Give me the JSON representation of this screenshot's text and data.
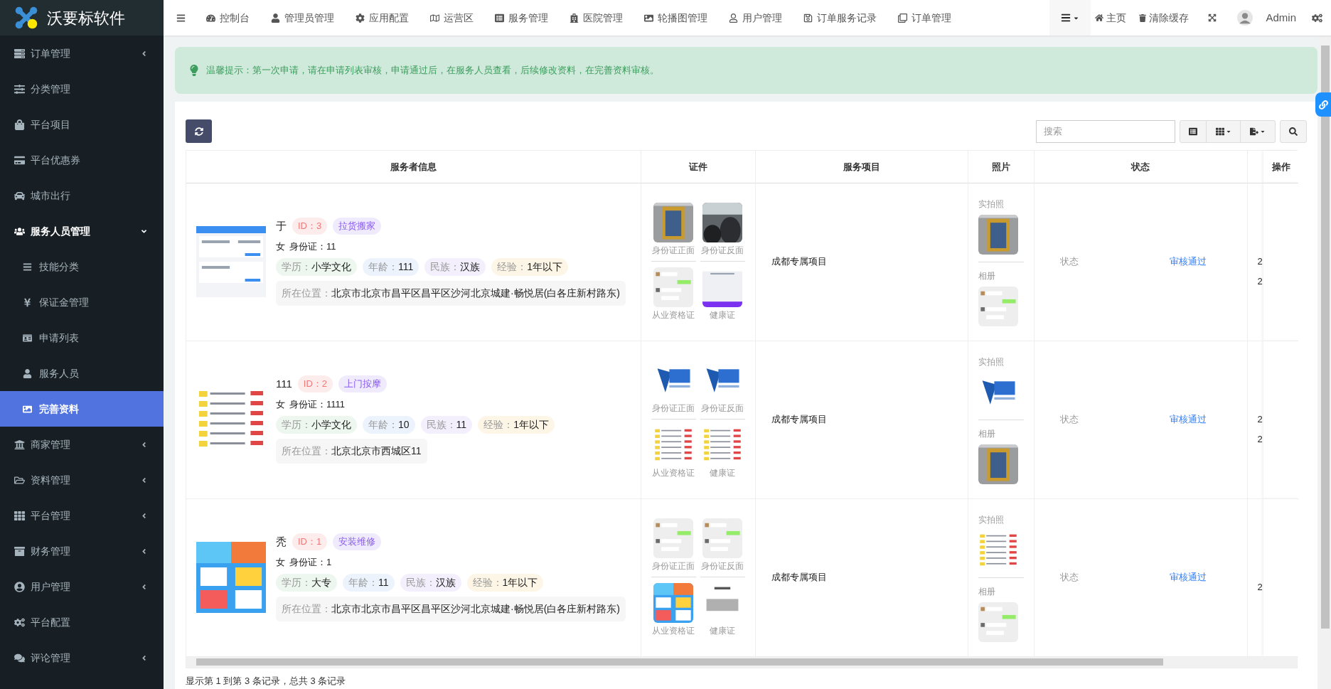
{
  "sidebar": {
    "logo": "沃要标软件",
    "items": [
      {
        "label": "订单管理",
        "expanded": false,
        "selected": false
      },
      {
        "label": "分类管理",
        "selected": false
      },
      {
        "label": "平台项目",
        "selected": false
      },
      {
        "label": "平台优惠券",
        "selected": false
      },
      {
        "label": "城市出行",
        "selected": false
      },
      {
        "label": "服务人员管理",
        "expanded": true,
        "selected": false,
        "children": [
          {
            "label": "技能分类",
            "selected": false
          },
          {
            "label": "保证金管理",
            "selected": false
          },
          {
            "label": "申请列表",
            "selected": false
          },
          {
            "label": "服务人员",
            "selected": false
          },
          {
            "label": "完善资料",
            "selected": true
          }
        ]
      },
      {
        "label": "商家管理",
        "expanded": false,
        "selected": false
      },
      {
        "label": "资料管理",
        "expanded": false,
        "selected": false
      },
      {
        "label": "平台管理",
        "expanded": false,
        "selected": false
      },
      {
        "label": "财务管理",
        "expanded": false,
        "selected": false
      },
      {
        "label": "用户管理",
        "expanded": false,
        "selected": false
      },
      {
        "label": "平台配置",
        "selected": false
      },
      {
        "label": "评论管理",
        "expanded": false,
        "selected": false
      }
    ]
  },
  "topbar": {
    "nav": [
      "控制台",
      "管理员管理",
      "应用配置",
      "运营区",
      "服务管理",
      "医院管理",
      "轮播图管理",
      "用户管理",
      "订单服务记录",
      "订单管理"
    ],
    "home": "主页",
    "clear_cache": "清除缓存",
    "user": "Admin"
  },
  "alert": "温馨提示：第一次申请，请在申请列表审核，申请通过后，在服务人员查看，后续修改资料，在完善资料审核。",
  "toolbar": {
    "search": {
      "placeholder": "搜索"
    }
  },
  "table": {
    "columns": [
      "服务者信息",
      "证件",
      "服务项目",
      "照片",
      "状态",
      "操作"
    ],
    "rows": [
      {
        "name": "于",
        "id": "ID：3",
        "category": "拉货搬家",
        "gender": "女",
        "id_card": "身份证：11",
        "tags": [
          {
            "label": "学历：",
            "value": "小学文化"
          },
          {
            "label": "年龄：",
            "value": "111"
          },
          {
            "label": "民族：",
            "value": "汉族"
          },
          {
            "label": "经验：",
            "value": "1年以下"
          }
        ],
        "location_label": "所在位置：",
        "location": "北京市北京市昌平区昌平区沙河北京城建·畅悦居(白各庄新村路东)",
        "documents": [
          "身份证正面",
          "身份证反面",
          "从业资格证",
          "健康证"
        ],
        "project": "成都专属项目",
        "photos": [
          "实拍照",
          "相册"
        ],
        "status_label": "状态",
        "status": "审核通过",
        "column_6": [
          "2",
          "2"
        ]
      },
      {
        "name": "111",
        "id": "ID：2",
        "category": "上门按摩",
        "gender": "女",
        "id_card": "身份证：1111",
        "tags": [
          {
            "label": "学历：",
            "value": "小学文化"
          },
          {
            "label": "年龄：",
            "value": "10"
          },
          {
            "label": "民族：",
            "value": "11"
          },
          {
            "label": "经验：",
            "value": "1年以下"
          }
        ],
        "location_label": "所在位置：",
        "location": "北京北京市西城区11",
        "documents": [
          "身份证正面",
          "身份证反面",
          "从业资格证",
          "健康证"
        ],
        "project": "成都专属项目",
        "photos": [
          "实拍照",
          "相册"
        ],
        "status_label": "状态",
        "status": "审核通过",
        "column_6": [
          "2",
          "2"
        ]
      },
      {
        "name": "秃",
        "id": "ID：1",
        "category": "安装维修",
        "gender": "女",
        "id_card": "身份证：1",
        "tags": [
          {
            "label": "学历：",
            "value": "大专"
          },
          {
            "label": "年龄：",
            "value": "11"
          },
          {
            "label": "民族：",
            "value": "汉族"
          },
          {
            "label": "经验：",
            "value": "1年以下"
          }
        ],
        "location_label": "所在位置：",
        "location": "北京市北京市昌平区昌平区沙河北京城建·畅悦居(白各庄新村路东)",
        "documents": [
          "身份证正面",
          "身份证反面",
          "从业资格证",
          "健康证"
        ],
        "project": "成都专属项目",
        "photos": [
          "实拍照",
          "相册"
        ],
        "status_label": "状态",
        "status": "审核通过",
        "column_6": [
          "2"
        ]
      }
    ]
  },
  "footer": "显示第 1 到第 3 条记录，总共 3 条记录"
}
